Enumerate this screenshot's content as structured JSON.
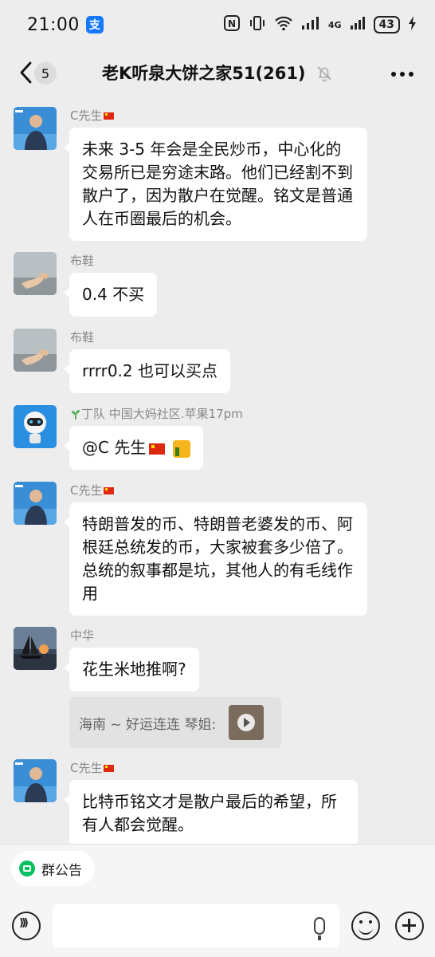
{
  "status_bar": {
    "time": "21:00",
    "app_badge": "支",
    "network": "4G",
    "battery": "43"
  },
  "header": {
    "back_count": "5",
    "title": "老K听泉大饼之家51(261)"
  },
  "messages": [
    {
      "sender": "C先生",
      "text": "未来 3-5 年会是全民炒币，中心化的交易所已是穷途末路。他们已经割不到散户了，因为散户在觉醒。铭文是普通人在币圈最后的机会。"
    },
    {
      "sender": "布鞋",
      "text": "0.4 不买"
    },
    {
      "sender": "布鞋",
      "text": "rrrr0.2 也可以买点"
    },
    {
      "sender": "丁队 中国大妈社区.苹果17pm",
      "text": "@C 先生"
    },
    {
      "sender": "C先生",
      "text": "特朗普发的币、特朗普老婆发的币、阿根廷总统发的币，大家被套多少倍了。总统的叙事都是坑，其他人的有毛线作用"
    },
    {
      "sender": "中华",
      "text": "花生米地推啊?",
      "quote": "海南 ~ 好运连连 琴姐:"
    },
    {
      "sender": "C先生",
      "text": "比特币铭文才是散户最后的希望，所有人都会觉醒。"
    }
  ],
  "footer": {
    "notice_label": "群公告"
  },
  "colors": {
    "background": "#ededed",
    "bubble": "#ffffff",
    "accent_green": "#07c160"
  }
}
